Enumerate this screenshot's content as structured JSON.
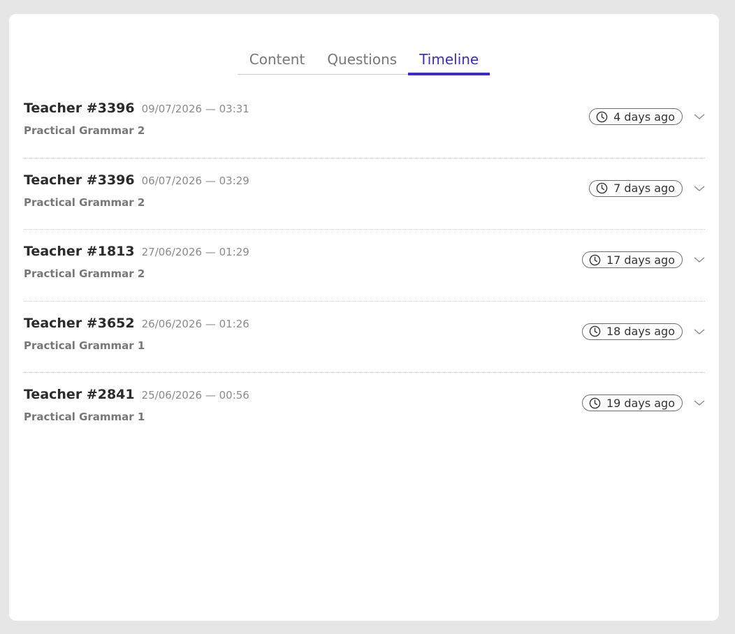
{
  "tabs": [
    {
      "label": "Content",
      "active": false
    },
    {
      "label": "Questions",
      "active": false
    },
    {
      "label": "Timeline",
      "active": true
    }
  ],
  "timeline": [
    {
      "teacher": "Teacher #3396",
      "date": "09/07/2026 — 03:31",
      "course": "Practical Grammar 2",
      "ago": "4 days ago"
    },
    {
      "teacher": "Teacher #3396",
      "date": "06/07/2026 — 03:29",
      "course": "Practical Grammar 2",
      "ago": "7 days ago"
    },
    {
      "teacher": "Teacher #1813",
      "date": "27/06/2026 — 01:29",
      "course": "Practical Grammar 2",
      "ago": "17 days ago"
    },
    {
      "teacher": "Teacher #3652",
      "date": "26/06/2026 — 01:26",
      "course": "Practical Grammar 1",
      "ago": "18 days ago"
    },
    {
      "teacher": "Teacher #2841",
      "date": "25/06/2026 — 00:56",
      "course": "Practical Grammar 1",
      "ago": "19 days ago"
    }
  ],
  "icons": {
    "time": "clock-icon",
    "expand": "chevron-down-icon"
  },
  "colors": {
    "accent": "#3b2bd0",
    "background": "#e6e6e6",
    "card": "#ffffff"
  }
}
